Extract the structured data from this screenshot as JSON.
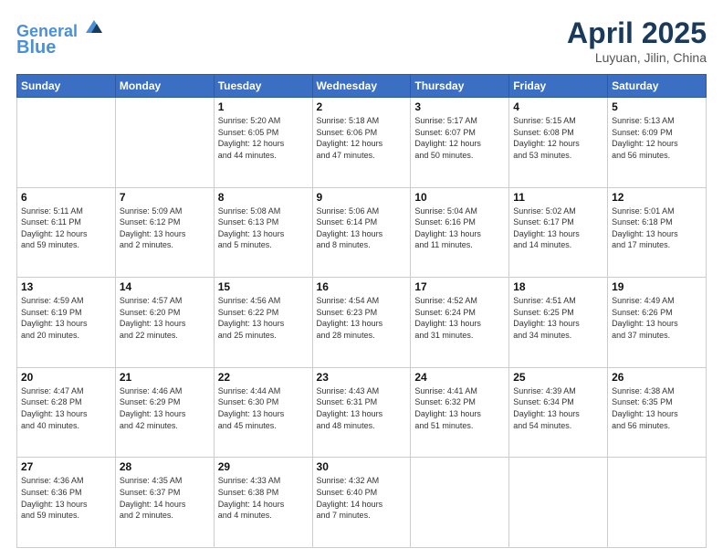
{
  "header": {
    "logo_line1": "General",
    "logo_line2": "Blue",
    "month": "April 2025",
    "location": "Luyuan, Jilin, China"
  },
  "weekdays": [
    "Sunday",
    "Monday",
    "Tuesday",
    "Wednesday",
    "Thursday",
    "Friday",
    "Saturday"
  ],
  "weeks": [
    [
      {
        "day": "",
        "info": ""
      },
      {
        "day": "",
        "info": ""
      },
      {
        "day": "1",
        "info": "Sunrise: 5:20 AM\nSunset: 6:05 PM\nDaylight: 12 hours\nand 44 minutes."
      },
      {
        "day": "2",
        "info": "Sunrise: 5:18 AM\nSunset: 6:06 PM\nDaylight: 12 hours\nand 47 minutes."
      },
      {
        "day": "3",
        "info": "Sunrise: 5:17 AM\nSunset: 6:07 PM\nDaylight: 12 hours\nand 50 minutes."
      },
      {
        "day": "4",
        "info": "Sunrise: 5:15 AM\nSunset: 6:08 PM\nDaylight: 12 hours\nand 53 minutes."
      },
      {
        "day": "5",
        "info": "Sunrise: 5:13 AM\nSunset: 6:09 PM\nDaylight: 12 hours\nand 56 minutes."
      }
    ],
    [
      {
        "day": "6",
        "info": "Sunrise: 5:11 AM\nSunset: 6:11 PM\nDaylight: 12 hours\nand 59 minutes."
      },
      {
        "day": "7",
        "info": "Sunrise: 5:09 AM\nSunset: 6:12 PM\nDaylight: 13 hours\nand 2 minutes."
      },
      {
        "day": "8",
        "info": "Sunrise: 5:08 AM\nSunset: 6:13 PM\nDaylight: 13 hours\nand 5 minutes."
      },
      {
        "day": "9",
        "info": "Sunrise: 5:06 AM\nSunset: 6:14 PM\nDaylight: 13 hours\nand 8 minutes."
      },
      {
        "day": "10",
        "info": "Sunrise: 5:04 AM\nSunset: 6:16 PM\nDaylight: 13 hours\nand 11 minutes."
      },
      {
        "day": "11",
        "info": "Sunrise: 5:02 AM\nSunset: 6:17 PM\nDaylight: 13 hours\nand 14 minutes."
      },
      {
        "day": "12",
        "info": "Sunrise: 5:01 AM\nSunset: 6:18 PM\nDaylight: 13 hours\nand 17 minutes."
      }
    ],
    [
      {
        "day": "13",
        "info": "Sunrise: 4:59 AM\nSunset: 6:19 PM\nDaylight: 13 hours\nand 20 minutes."
      },
      {
        "day": "14",
        "info": "Sunrise: 4:57 AM\nSunset: 6:20 PM\nDaylight: 13 hours\nand 22 minutes."
      },
      {
        "day": "15",
        "info": "Sunrise: 4:56 AM\nSunset: 6:22 PM\nDaylight: 13 hours\nand 25 minutes."
      },
      {
        "day": "16",
        "info": "Sunrise: 4:54 AM\nSunset: 6:23 PM\nDaylight: 13 hours\nand 28 minutes."
      },
      {
        "day": "17",
        "info": "Sunrise: 4:52 AM\nSunset: 6:24 PM\nDaylight: 13 hours\nand 31 minutes."
      },
      {
        "day": "18",
        "info": "Sunrise: 4:51 AM\nSunset: 6:25 PM\nDaylight: 13 hours\nand 34 minutes."
      },
      {
        "day": "19",
        "info": "Sunrise: 4:49 AM\nSunset: 6:26 PM\nDaylight: 13 hours\nand 37 minutes."
      }
    ],
    [
      {
        "day": "20",
        "info": "Sunrise: 4:47 AM\nSunset: 6:28 PM\nDaylight: 13 hours\nand 40 minutes."
      },
      {
        "day": "21",
        "info": "Sunrise: 4:46 AM\nSunset: 6:29 PM\nDaylight: 13 hours\nand 42 minutes."
      },
      {
        "day": "22",
        "info": "Sunrise: 4:44 AM\nSunset: 6:30 PM\nDaylight: 13 hours\nand 45 minutes."
      },
      {
        "day": "23",
        "info": "Sunrise: 4:43 AM\nSunset: 6:31 PM\nDaylight: 13 hours\nand 48 minutes."
      },
      {
        "day": "24",
        "info": "Sunrise: 4:41 AM\nSunset: 6:32 PM\nDaylight: 13 hours\nand 51 minutes."
      },
      {
        "day": "25",
        "info": "Sunrise: 4:39 AM\nSunset: 6:34 PM\nDaylight: 13 hours\nand 54 minutes."
      },
      {
        "day": "26",
        "info": "Sunrise: 4:38 AM\nSunset: 6:35 PM\nDaylight: 13 hours\nand 56 minutes."
      }
    ],
    [
      {
        "day": "27",
        "info": "Sunrise: 4:36 AM\nSunset: 6:36 PM\nDaylight: 13 hours\nand 59 minutes."
      },
      {
        "day": "28",
        "info": "Sunrise: 4:35 AM\nSunset: 6:37 PM\nDaylight: 14 hours\nand 2 minutes."
      },
      {
        "day": "29",
        "info": "Sunrise: 4:33 AM\nSunset: 6:38 PM\nDaylight: 14 hours\nand 4 minutes."
      },
      {
        "day": "30",
        "info": "Sunrise: 4:32 AM\nSunset: 6:40 PM\nDaylight: 14 hours\nand 7 minutes."
      },
      {
        "day": "",
        "info": ""
      },
      {
        "day": "",
        "info": ""
      },
      {
        "day": "",
        "info": ""
      }
    ]
  ]
}
